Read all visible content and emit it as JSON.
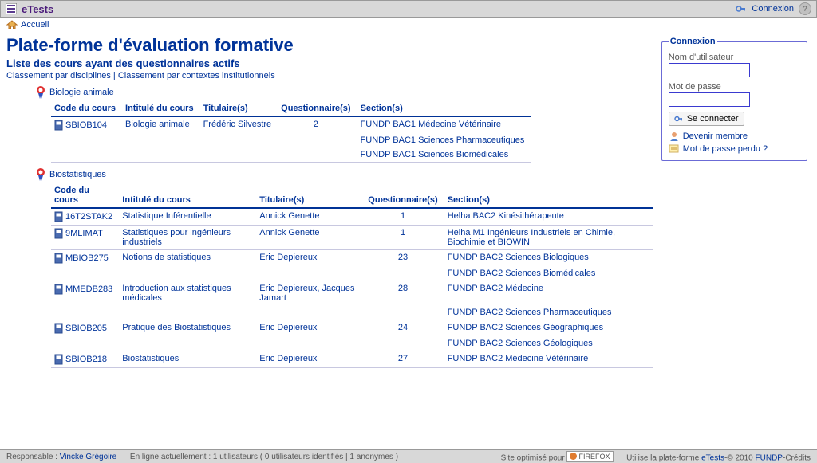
{
  "app": {
    "title": "eTests"
  },
  "topbar": {
    "connexion": "Connexion"
  },
  "breadcrumb": {
    "home": "Accueil"
  },
  "page": {
    "title": "Plate-forme d'évaluation formative",
    "subtitle": "Liste des cours ayant des questionnaires actifs",
    "sort_disciplines": "Classement par disciplines",
    "sort_context": "Classement par contextes institutionnels"
  },
  "headers": {
    "code": "Code du cours",
    "intitule": "Intitulé du cours",
    "titulaire": "Titulaire(s)",
    "quest": "Questionnaire(s)",
    "section": "Section(s)"
  },
  "disc1": {
    "name": "Biologie animale",
    "rows": [
      {
        "code": "SBIOB104",
        "intitule": "Biologie animale",
        "titulaire": "Frédéric Silvestre",
        "q": "2",
        "sections": [
          "FUNDP BAC1 Médecine Vétérinaire",
          "FUNDP BAC1 Sciences Pharmaceutiques",
          "FUNDP BAC1 Sciences Biomédicales"
        ]
      }
    ]
  },
  "disc2": {
    "name": "Biostatistiques",
    "rows": [
      {
        "code": "16T2STAK2",
        "intitule": "Statistique Inférentielle",
        "titulaire": "Annick Genette",
        "q": "1",
        "sections": [
          "Helha BAC2 Kinésithérapeute"
        ]
      },
      {
        "code": "9MLIMAT",
        "intitule": "Statistiques pour ingénieurs industriels",
        "titulaire": "Annick Genette",
        "q": "1",
        "sections": [
          "Helha M1 Ingénieurs Industriels en Chimie, Biochimie et BIOWIN"
        ]
      },
      {
        "code": "MBIOB275",
        "intitule": "Notions de statistiques",
        "titulaire": "Eric Depiereux",
        "q": "23",
        "sections": [
          "FUNDP BAC2 Sciences Biologiques",
          "FUNDP BAC2 Sciences Biomédicales"
        ]
      },
      {
        "code": "MMEDB283",
        "intitule": "Introduction aux statistiques médicales",
        "titulaire": "Eric Depiereux, Jacques Jamart",
        "q": "28",
        "sections": [
          "FUNDP BAC2 Médecine",
          "FUNDP BAC2 Sciences Pharmaceutiques"
        ]
      },
      {
        "code": "SBIOB205",
        "intitule": "Pratique des Biostatistiques",
        "titulaire": "Eric Depiereux",
        "q": "24",
        "sections": [
          "FUNDP BAC2 Sciences Géographiques",
          "FUNDP BAC2 Sciences Géologiques"
        ]
      },
      {
        "code": "SBIOB218",
        "intitule": "Biostatistiques",
        "titulaire": "Eric Depiereux",
        "q": "27",
        "sections": [
          "FUNDP BAC2 Médecine Vétérinaire"
        ]
      }
    ]
  },
  "login": {
    "legend": "Connexion",
    "user_label": "Nom d'utilisateur",
    "pass_label": "Mot de passe",
    "submit": "Se connecter",
    "register": "Devenir membre",
    "forgot": "Mot de passe perdu ?"
  },
  "footer": {
    "resp_label": "Responsable :",
    "resp_name": "Vincke Grégoire",
    "online": "En ligne actuellement : 1 utilisateurs ( 0 utilisateurs identifiés | 1 anonymes )",
    "optim": "Site optimisé pour",
    "firefox": "FIREFOX",
    "uses_prefix": "Utilise la plate-forme",
    "etests": "eTests",
    "copyright_mid": "-© 2010",
    "fundp": "FUNDP",
    "credits": "-Crédits"
  }
}
